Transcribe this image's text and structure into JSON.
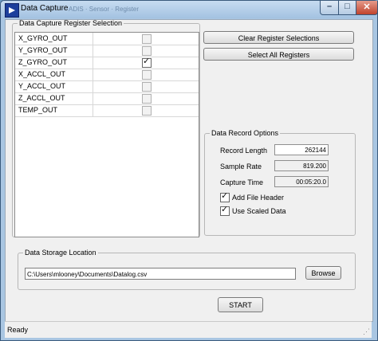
{
  "window": {
    "title": "Data Capture",
    "ghost_title": "ADIS · Sensor · Register"
  },
  "register_selection": {
    "legend": "Data Capture Register Selection",
    "rows": [
      {
        "name": "X_GYRO_OUT",
        "checked": false
      },
      {
        "name": "Y_GYRO_OUT",
        "checked": false
      },
      {
        "name": "Z_GYRO_OUT",
        "checked": true
      },
      {
        "name": "X_ACCL_OUT",
        "checked": false
      },
      {
        "name": "Y_ACCL_OUT",
        "checked": false
      },
      {
        "name": "Z_ACCL_OUT",
        "checked": false
      },
      {
        "name": "TEMP_OUT",
        "checked": false
      }
    ]
  },
  "buttons": {
    "clear": "Clear Register Selections",
    "select_all": "Select All Registers",
    "browse": "Browse",
    "start": "START"
  },
  "record_options": {
    "legend": "Data Record Options",
    "record_length_label": "Record Length",
    "record_length": "262144",
    "sample_rate_label": "Sample Rate",
    "sample_rate": "819.200",
    "capture_time_label": "Capture Time",
    "capture_time": "00:05:20.0",
    "add_file_header_label": "Add File Header",
    "add_file_header": true,
    "use_scaled_label": "Use Scaled Data",
    "use_scaled": true
  },
  "storage": {
    "legend": "Data Storage Location",
    "path": "C:\\Users\\mlooney\\Documents\\Datalog.csv"
  },
  "status": "Ready"
}
